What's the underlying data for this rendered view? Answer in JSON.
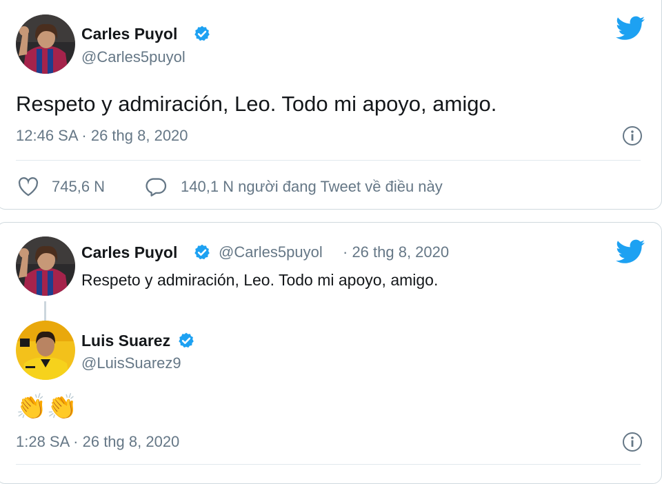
{
  "tweet1": {
    "author_name": "Carles Puyol",
    "author_handle": "@Carles5puyol",
    "text": "Respeto y admiración, Leo. Todo mi apoyo, amigo.",
    "timestamp": "12:46 SA · 26 thg 8, 2020",
    "likes": "745,6 N",
    "retweet_talk": "140,1 N người đang Tweet về điều này",
    "icons": [
      "verified-badge-icon",
      "twitter-bird-icon",
      "info-icon",
      "heart-icon",
      "reply-bubble-icon"
    ]
  },
  "tweet2": {
    "quoted": {
      "author_name": "Carles Puyol",
      "author_handle": "@Carles5puyol",
      "date": "· 26 thg 8, 2020",
      "text": "Respeto y admiración, Leo. Todo mi apoyo, amigo."
    },
    "reply": {
      "author_name": "Luis Suarez",
      "author_handle": "@LuisSuarez9",
      "text": "👏👏",
      "timestamp": "1:28 SA · 26 thg 8, 2020"
    }
  },
  "colors": {
    "twitter_blue": "#1da1f2",
    "muted_text": "#657786",
    "primary_text": "#14171a",
    "border": "#cfd9de"
  }
}
